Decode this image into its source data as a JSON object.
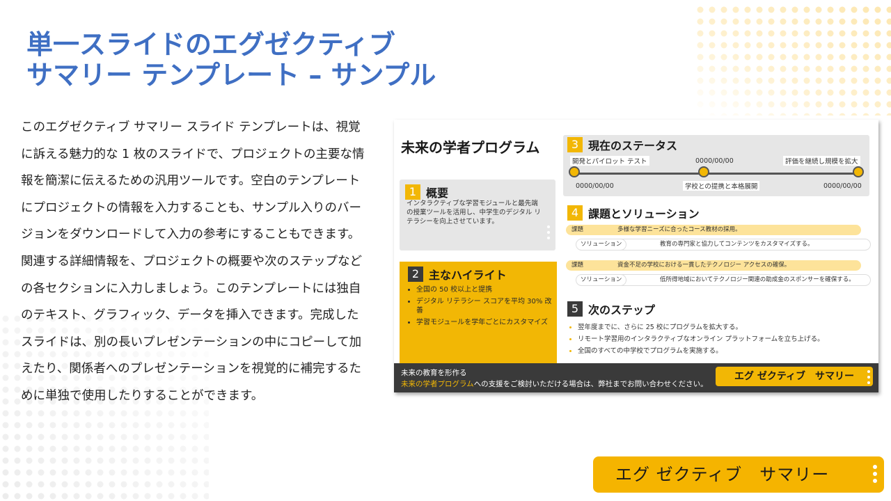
{
  "title": {
    "line1": "単一スライドのエグゼクティブ",
    "line2": "サマリー テンプレート – サンプル"
  },
  "description": "このエグゼクティブ サマリー スライド テンプレートは、視覚に訴える魅力的な 1 枚のスライドで、プロジェクトの主要な情報を簡潔に伝えるための汎用ツールです。空白のテンプレートにプロジェクトの情報を入力することも、サンプル入りのバージョンをダウンロードして入力の参考にすることもできます。関連する詳細情報を、プロジェクトの概要や次のステップなどの各セクションに入力しましょう。このテンプレートには独自のテキスト、グラフィック、データを挿入できます。完成したスライドは、別の長いプレゼンテーションの中にコピーして加えたり、関係者へのプレゼンテーションを視覚的に補完するために単独で使用したりすることができます。",
  "slide": {
    "title": "未来の学者プログラム",
    "overview": {
      "num": "1",
      "title": "概要",
      "text": "インタラクティブな学習モジュールと最先端の授業ツールを活用し、中学生のデジタル リテラシーを向上させています。"
    },
    "highlights": {
      "num": "2",
      "title": "主なハイライト",
      "items": [
        "全国の 50 校以上と提携",
        "デジタル リテラシー スコアを平均 30% 改善",
        "学習モジュールを学年ごとにカスタマイズ"
      ]
    },
    "status": {
      "num": "3",
      "title": "現在のステータス",
      "milestones": [
        {
          "label": "開発とパイロット テスト",
          "date": "0000/00/00"
        },
        {
          "label": "学校との提携と本格展開",
          "date": "0000/00/00"
        },
        {
          "label": "評価を継続し規模を拡大",
          "date": "0000/00/00"
        }
      ]
    },
    "challenges": {
      "num": "4",
      "title": "課題とソリューション",
      "challenge_label": "課題",
      "solution_label": "ソリューション",
      "pairs": [
        {
          "challenge": "多様な学習ニーズに合ったコース教材の採用。",
          "solution": "教育の専門家と協力してコンテンツをカスタマイズする。"
        },
        {
          "challenge": "資金不足の学校における一貫したテクノロジー アクセスの確保。",
          "solution": "低所得地域においてテクノロジー関連の助成金のスポンサーを確保する。"
        }
      ]
    },
    "next_steps": {
      "num": "5",
      "title": "次のステップ",
      "items": [
        "翌年度までに、さらに 25 校にプログラムを拡大する。",
        "リモート学習用のインタラクティブなオンライン プラットフォームを立ち上げる。",
        "全国のすべての中学校でプログラムを実施する。"
      ]
    },
    "footer": {
      "line1": "未来の教育を形作る",
      "highlight": "未来の学者プログラム",
      "line2_rest": "への支援をご検討いただける場合は、弊社までお問い合わせください。",
      "button": "エグ ゼクティブ　サマリー"
    }
  },
  "page_button": "エグ ゼクティブ　サマリー",
  "colors": {
    "title_blue": "#3f6fc3",
    "accent_yellow": "#f2b705",
    "dark": "#3a3a3a"
  }
}
